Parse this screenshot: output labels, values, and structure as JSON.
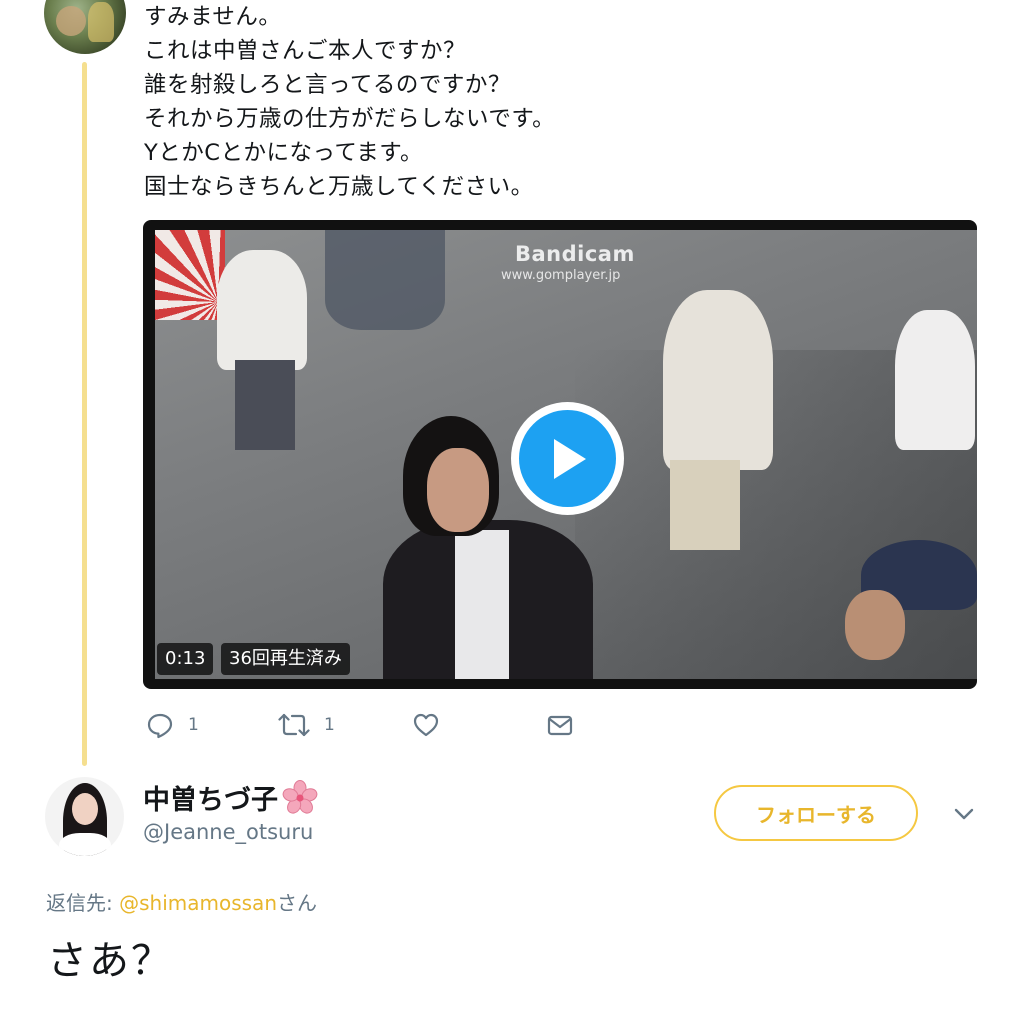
{
  "reply_tweet": {
    "lines": [
      "すみません。",
      "これは中曽さんご本人ですか？",
      "誰を射殺しろと言ってるのですか？",
      "それから万歳の仕方がだらしないです。",
      "YとかCとかになってます。",
      "国士ならきちんと万歳してください。"
    ],
    "video": {
      "watermark_title": "Bandicam",
      "watermark_url": "www.gomplayer.jp",
      "duration": "0:13",
      "views": "36回再生済み"
    },
    "actions": {
      "reply_count": "1",
      "retweet_count": "1"
    }
  },
  "main_tweet": {
    "display_name": "中曽ちづ子",
    "handle": "@Jeanne_otsuru",
    "follow_label": "フォローする",
    "reply_prefix": "返信先: ",
    "reply_mention": "@shimamossan",
    "reply_suffix": "さん",
    "text": "さあ？"
  },
  "colors": {
    "thread_line": "#f5df8f",
    "accent": "#e8b62c",
    "play_blue": "#1da1f2",
    "secondary_text": "#657786"
  },
  "icons": {
    "reply": "reply-icon",
    "retweet": "retweet-icon",
    "like": "heart-icon",
    "dm": "envelope-icon",
    "play": "play-icon",
    "flower": "cherry-blossom-icon",
    "more": "chevron-down-icon"
  }
}
